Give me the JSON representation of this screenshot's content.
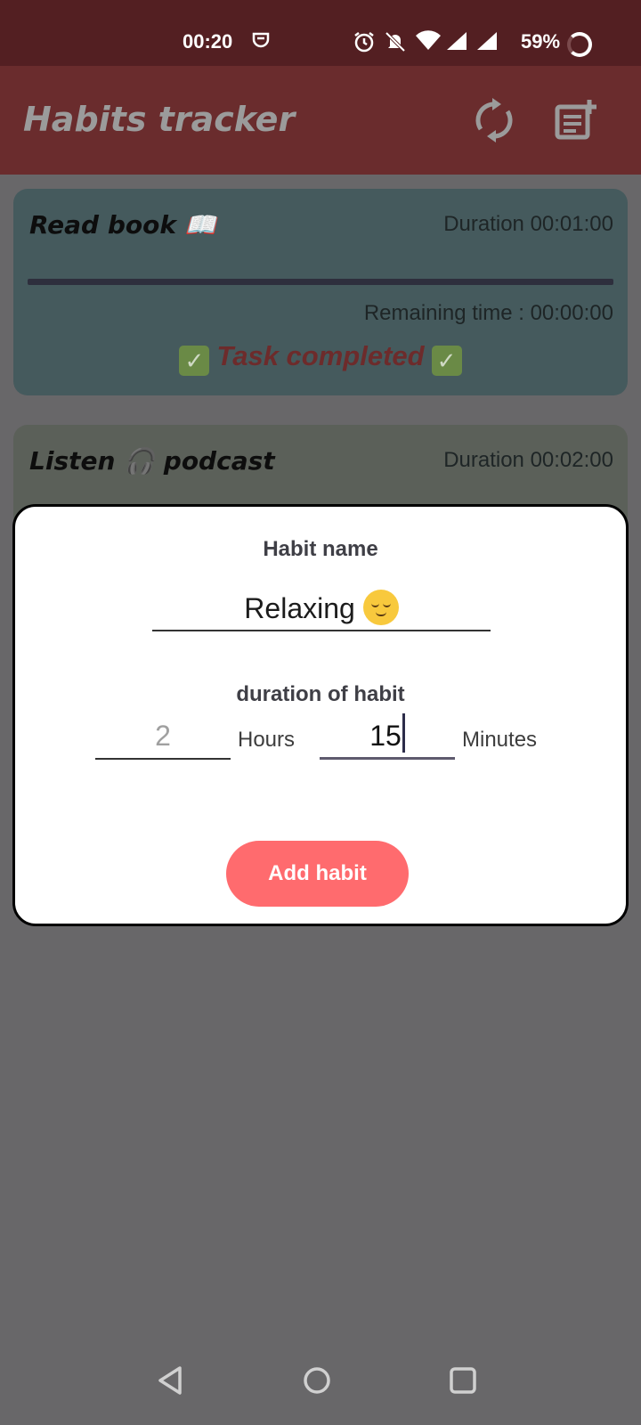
{
  "status_bar": {
    "time": "00:20",
    "battery": "59%",
    "icons": [
      "notification-icon",
      "alarm-icon",
      "mute-icon",
      "wifi-icon",
      "signal-icon",
      "signal-icon",
      "battery-icon"
    ]
  },
  "app_bar": {
    "title": "Habits tracker",
    "actions": [
      "refresh-icon",
      "add-note-icon"
    ]
  },
  "habits": [
    {
      "title": "Read book 📖",
      "duration": "Duration 00:01:00",
      "remaining": "Remaining time : 00:00:00",
      "status": "Task completed",
      "progress": 1.0
    },
    {
      "title": "Listen 🎧 podcast",
      "duration": "Duration 00:02:00"
    }
  ],
  "dialog": {
    "name_label": "Habit name",
    "name_value": "Relaxing",
    "duration_label": "duration of habit",
    "hours_value": "2",
    "hours_label": "Hours",
    "minutes_value": "15",
    "minutes_label": "Minutes",
    "add_button": "Add habit"
  },
  "colors": {
    "status_bar": "#531F22",
    "app_bar": "#6A2C2D",
    "card_completed": "#455A5D",
    "card_two": "#5B6059",
    "add_button": "#FF6B6E",
    "scrim": "#686769"
  }
}
